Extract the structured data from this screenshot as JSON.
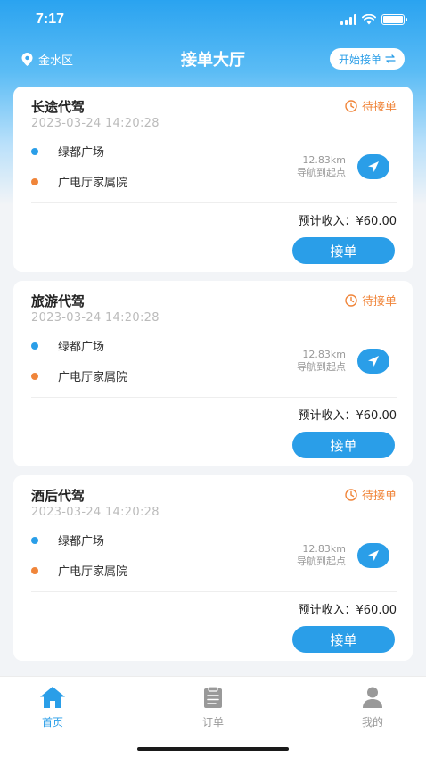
{
  "status_bar": {
    "time": "7:17"
  },
  "header": {
    "location": "金水区",
    "title": "接单大厅",
    "start_button": "开始接单"
  },
  "orders": [
    {
      "type": "长途代驾",
      "status": "待接单",
      "time": "2023-03-24  14:20:28",
      "start": "绿都广场",
      "end": "广电厅家属院",
      "distance": "12.83km",
      "nav_text": "导航到起点",
      "income_label": "预计收入：",
      "income_value": "¥60.00",
      "accept_label": "接单"
    },
    {
      "type": "旅游代驾",
      "status": "待接单",
      "time": "2023-03-24  14:20:28",
      "start": "绿都广场",
      "end": "广电厅家属院",
      "distance": "12.83km",
      "nav_text": "导航到起点",
      "income_label": "预计收入：",
      "income_value": "¥60.00",
      "accept_label": "接单"
    },
    {
      "type": "酒后代驾",
      "status": "待接单",
      "time": "2023-03-24  14:20:28",
      "start": "绿都广场",
      "end": "广电厅家属院",
      "distance": "12.83km",
      "nav_text": "导航到起点",
      "income_label": "预计收入：",
      "income_value": "¥60.00",
      "accept_label": "接单"
    }
  ],
  "tabbar": {
    "items": [
      {
        "label": "首页",
        "icon": "home-icon",
        "active": true
      },
      {
        "label": "订单",
        "icon": "clipboard-icon",
        "active": false
      },
      {
        "label": "我的",
        "icon": "user-icon",
        "active": false
      }
    ]
  },
  "colors": {
    "primary": "#2a9ee8",
    "status_pending": "#f0853a",
    "start_dot": "#2a9ee8",
    "end_dot": "#f0853a"
  }
}
